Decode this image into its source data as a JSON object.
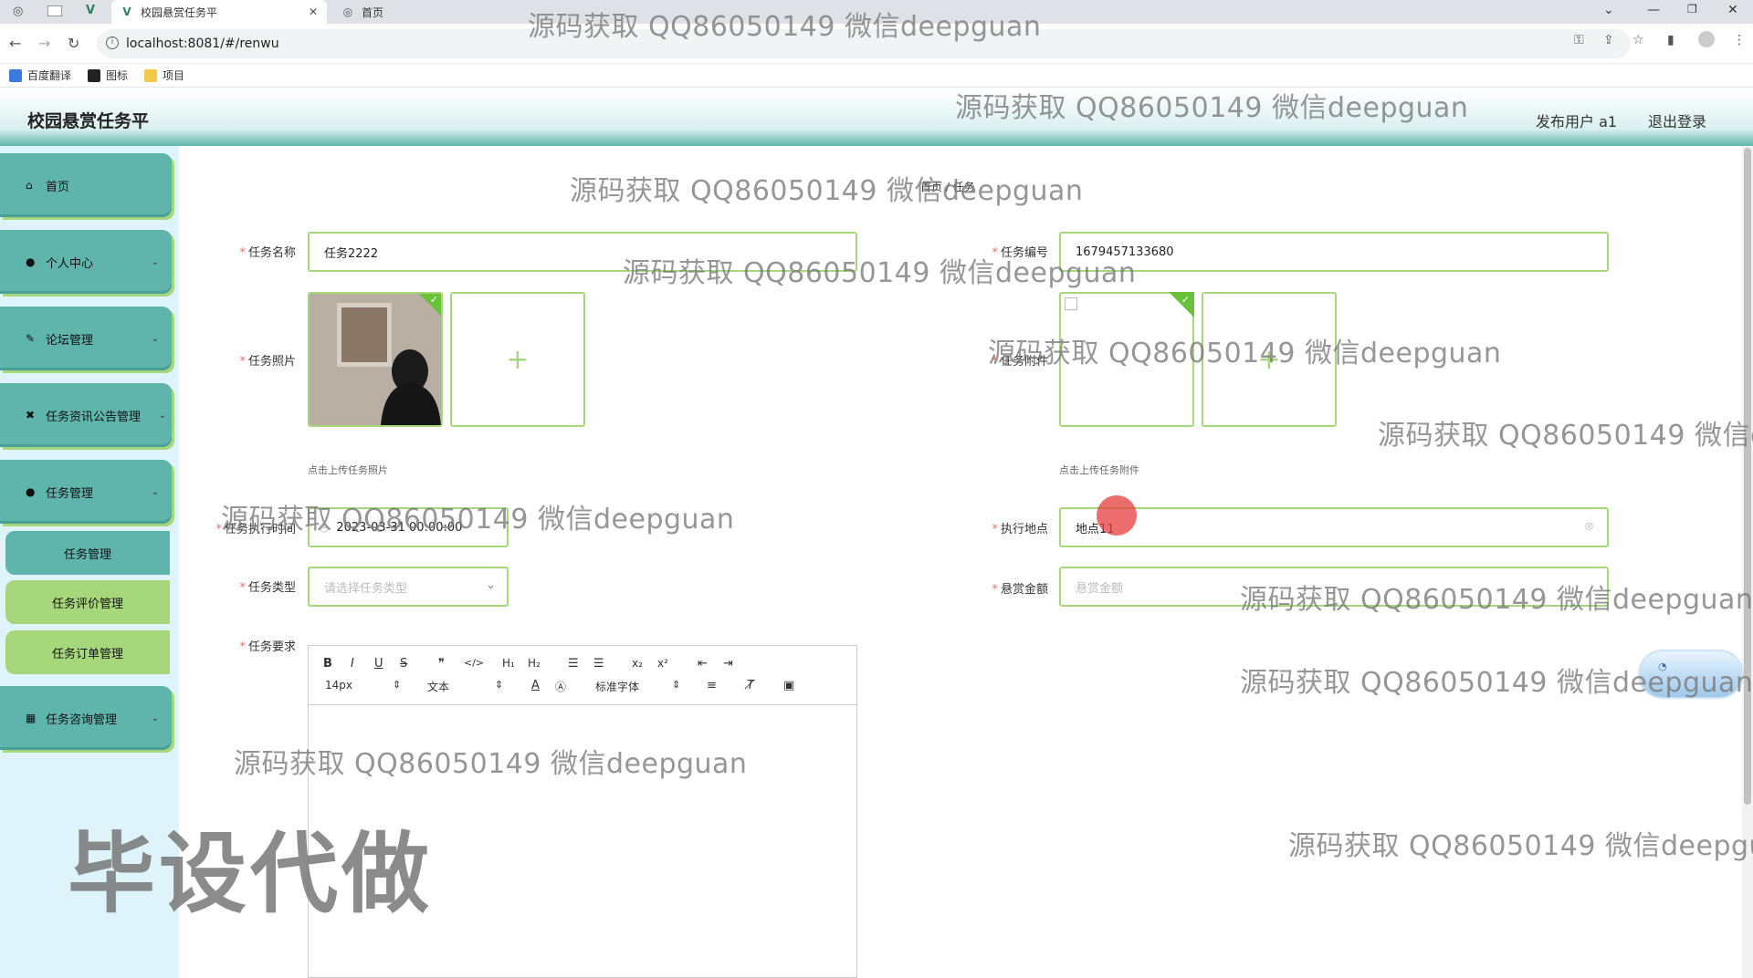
{
  "browser": {
    "tabs": [
      {
        "title": "校园悬赏任务平",
        "active": true
      },
      {
        "title": "首页",
        "active": false
      }
    ],
    "url": "localhost:8081/#/renwu",
    "bookmarks": [
      "百度翻译",
      "图标",
      "项目"
    ]
  },
  "header": {
    "title": "校园悬赏任务平",
    "user": "发布用户 a1",
    "logout": "退出登录"
  },
  "sidebar": {
    "items": [
      {
        "label": "首页",
        "icon": "home-icon"
      },
      {
        "label": "个人中心",
        "icon": "user-icon"
      },
      {
        "label": "论坛管理",
        "icon": "forum-icon"
      },
      {
        "label": "任务资讯公告管理",
        "icon": "news-icon"
      },
      {
        "label": "任务管理",
        "icon": "user-icon"
      }
    ],
    "subitems": [
      "任务管理",
      "任务评价管理",
      "任务订单管理"
    ],
    "last_item": {
      "label": "任务咨询管理",
      "icon": "grid-icon"
    }
  },
  "breadcrumb": "首页 / 任务",
  "form": {
    "name_label": "任务名称",
    "name_value": "任务2222",
    "code_label": "任务编号",
    "code_value": "1679457133680",
    "photo_label": "任务照片",
    "photo_hint": "点击上传任务照片",
    "file_label": "任务附件",
    "file_hint": "点击上传任务附件",
    "time_label": "任务执行时间",
    "time_value": "2023-03-31 00:00:00",
    "place_label": "执行地点",
    "place_value": "地点11",
    "type_label": "任务类型",
    "type_placeholder": "请选择任务类型",
    "reward_label": "悬赏金额",
    "reward_placeholder": "悬赏金额",
    "req_label": "任务要求"
  },
  "editor": {
    "font_size": "14px",
    "text_style": "文本",
    "font_family": "标准字体"
  },
  "watermarks": {
    "text": "源码获取 QQ86050149 微信deepguan",
    "text_cut1": "源码获取 QQ86050149 微信d",
    "text_cut2": "源码获取 QQ86050149 微信deepgua",
    "big": "毕设代做"
  },
  "colors": {
    "teal": "#5fb5ac",
    "green_border": "#a6d77a",
    "sidebar_bg": "#dff4fa",
    "required": "#f56c6c"
  }
}
